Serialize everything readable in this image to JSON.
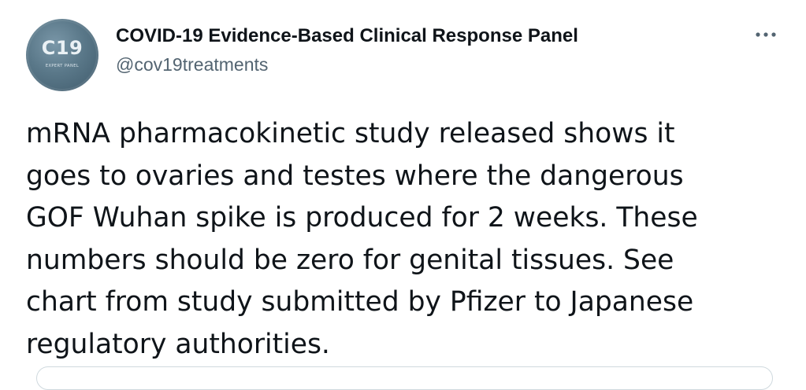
{
  "tweet": {
    "author": {
      "display_name": "COVID-19 Evidence-Based Clinical Response Panel",
      "handle": "@cov19treatments",
      "avatar_text": "C19",
      "avatar_subtext": "EXPERT PANEL",
      "avatar_color": "#5a7889"
    },
    "more_icon": "more-horizontal-icon",
    "text": "mRNA pharmacokinetic study released shows it\ngoes to ovaries and testes where the dangerous\nGOF Wuhan spike is produced for 2 weeks.  These\nnumbers should be zero for genital tissues.  See\nchart from study submitted by Pfizer to Japanese\nregulatory authorities."
  },
  "colors": {
    "text_primary": "#0f1419",
    "text_secondary": "#536471",
    "border": "#cfd9de"
  }
}
